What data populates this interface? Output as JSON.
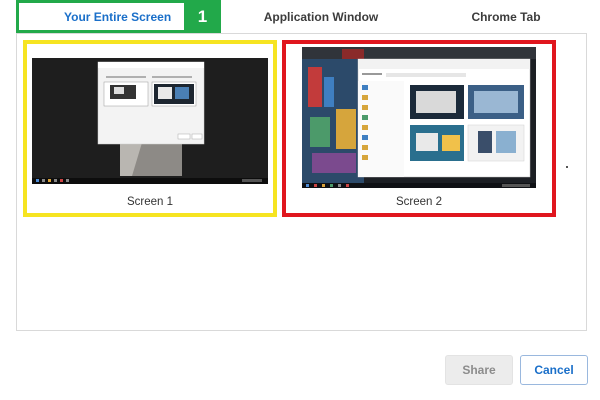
{
  "tabs": {
    "entire_screen": "Your Entire Screen",
    "step_number": "1",
    "application_window": "Application Window",
    "chrome_tab": "Chrome Tab"
  },
  "screens": [
    {
      "label": "Screen 1",
      "highlight": "#f6e421"
    },
    {
      "label": "Screen 2",
      "highlight": "#e0161e"
    }
  ],
  "buttons": {
    "share": "Share",
    "cancel": "Cancel"
  },
  "colors": {
    "active_tab_accent": "#22a94a",
    "link_blue": "#1a6fc9"
  }
}
